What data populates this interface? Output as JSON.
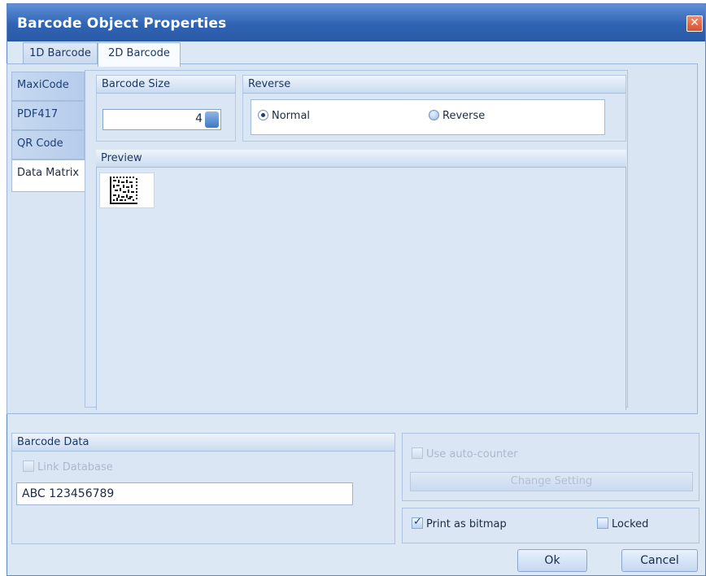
{
  "window": {
    "title": "Barcode Object Properties",
    "close_icon": "close-icon"
  },
  "tabs": [
    {
      "label": "1D Barcode",
      "active": false
    },
    {
      "label": "2D Barcode",
      "active": true
    }
  ],
  "side_tabs": [
    {
      "label": "MaxiCode",
      "active": false
    },
    {
      "label": "PDF417",
      "active": false
    },
    {
      "label": "QR Code",
      "active": false
    },
    {
      "label": "Data Matrix",
      "active": true
    }
  ],
  "barcode_size": {
    "header": "Barcode Size",
    "value": "4"
  },
  "reverse": {
    "header": "Reverse",
    "options": [
      {
        "label": "Normal",
        "selected": true
      },
      {
        "label": "Reverse",
        "selected": false
      }
    ]
  },
  "preview": {
    "header": "Preview"
  },
  "barcode_data": {
    "header": "Barcode Data",
    "link_database_label": "Link Database",
    "value": "ABC 123456789"
  },
  "counter": {
    "use_auto_counter_label": "Use auto-counter",
    "change_setting_label": "Change Setting"
  },
  "options": {
    "print_as_bitmap_label": "Print as bitmap",
    "print_as_bitmap_checked": true,
    "locked_label": "Locked",
    "locked_checked": false
  },
  "buttons": {
    "ok": "Ok",
    "cancel": "Cancel"
  }
}
